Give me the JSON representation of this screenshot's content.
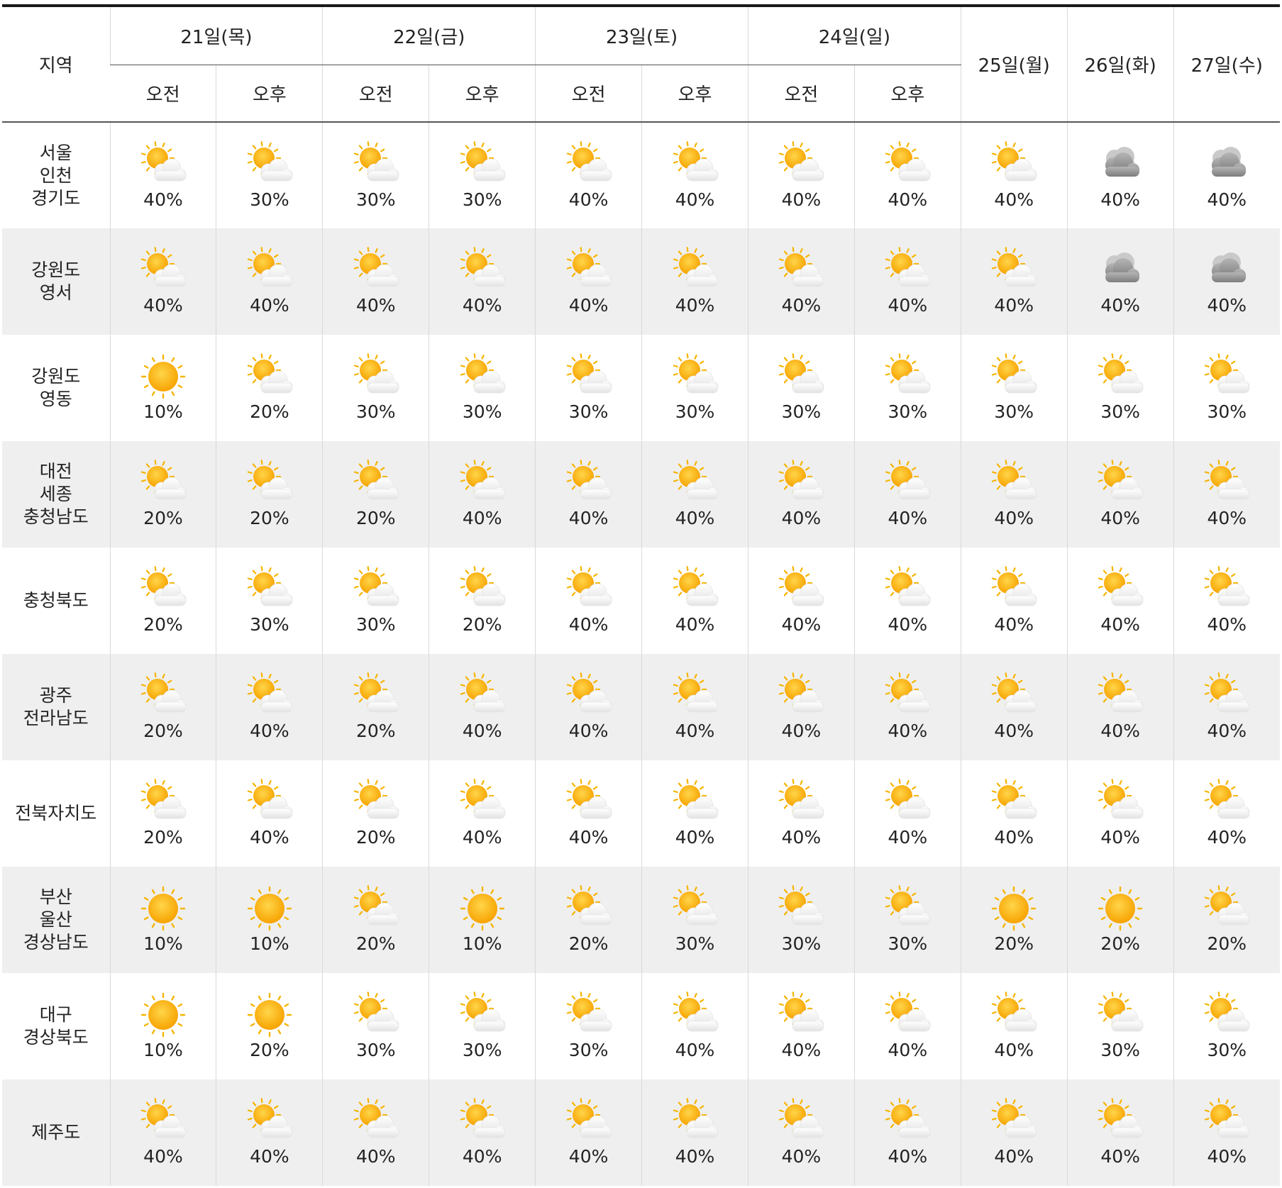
{
  "header": {
    "region_label": "지역",
    "dates": [
      {
        "label": "21일(목)",
        "split": true
      },
      {
        "label": "22일(금)",
        "split": true
      },
      {
        "label": "23일(토)",
        "split": true
      },
      {
        "label": "24일(일)",
        "split": true
      },
      {
        "label": "25일(월)",
        "split": false
      },
      {
        "label": "26일(화)",
        "split": false
      },
      {
        "label": "27일(수)",
        "split": false
      }
    ],
    "am_label": "오전",
    "pm_label": "오후"
  },
  "rows": [
    {
      "region": [
        "서울",
        "인천",
        "경기도"
      ],
      "cells": [
        {
          "icon": "partly-cloudy-icon",
          "pct": "40%"
        },
        {
          "icon": "partly-cloudy-icon",
          "pct": "30%"
        },
        {
          "icon": "partly-cloudy-icon",
          "pct": "30%"
        },
        {
          "icon": "partly-cloudy-icon",
          "pct": "30%"
        },
        {
          "icon": "partly-cloudy-icon",
          "pct": "40%"
        },
        {
          "icon": "partly-cloudy-icon",
          "pct": "40%"
        },
        {
          "icon": "partly-cloudy-icon",
          "pct": "40%"
        },
        {
          "icon": "partly-cloudy-icon",
          "pct": "40%"
        },
        {
          "icon": "partly-cloudy-icon",
          "pct": "40%"
        },
        {
          "icon": "overcast-icon",
          "pct": "40%"
        },
        {
          "icon": "overcast-icon",
          "pct": "40%"
        }
      ]
    },
    {
      "region": [
        "강원도",
        "영서"
      ],
      "cells": [
        {
          "icon": "partly-cloudy-icon",
          "pct": "40%"
        },
        {
          "icon": "partly-cloudy-icon",
          "pct": "40%"
        },
        {
          "icon": "partly-cloudy-icon",
          "pct": "40%"
        },
        {
          "icon": "partly-cloudy-icon",
          "pct": "40%"
        },
        {
          "icon": "partly-cloudy-icon",
          "pct": "40%"
        },
        {
          "icon": "partly-cloudy-icon",
          "pct": "40%"
        },
        {
          "icon": "partly-cloudy-icon",
          "pct": "40%"
        },
        {
          "icon": "partly-cloudy-icon",
          "pct": "40%"
        },
        {
          "icon": "partly-cloudy-icon",
          "pct": "40%"
        },
        {
          "icon": "overcast-icon",
          "pct": "40%"
        },
        {
          "icon": "overcast-icon",
          "pct": "40%"
        }
      ]
    },
    {
      "region": [
        "강원도",
        "영동"
      ],
      "cells": [
        {
          "icon": "sunny-icon",
          "pct": "10%"
        },
        {
          "icon": "partly-cloudy-icon",
          "pct": "20%"
        },
        {
          "icon": "partly-cloudy-icon",
          "pct": "30%"
        },
        {
          "icon": "partly-cloudy-icon",
          "pct": "30%"
        },
        {
          "icon": "partly-cloudy-icon",
          "pct": "30%"
        },
        {
          "icon": "partly-cloudy-icon",
          "pct": "30%"
        },
        {
          "icon": "partly-cloudy-icon",
          "pct": "30%"
        },
        {
          "icon": "partly-cloudy-icon",
          "pct": "30%"
        },
        {
          "icon": "partly-cloudy-icon",
          "pct": "30%"
        },
        {
          "icon": "partly-cloudy-icon",
          "pct": "30%"
        },
        {
          "icon": "partly-cloudy-icon",
          "pct": "30%"
        }
      ]
    },
    {
      "region": [
        "대전",
        "세종",
        "충청남도"
      ],
      "cells": [
        {
          "icon": "partly-cloudy-icon",
          "pct": "20%"
        },
        {
          "icon": "partly-cloudy-icon",
          "pct": "20%"
        },
        {
          "icon": "partly-cloudy-icon",
          "pct": "20%"
        },
        {
          "icon": "partly-cloudy-icon",
          "pct": "40%"
        },
        {
          "icon": "partly-cloudy-icon",
          "pct": "40%"
        },
        {
          "icon": "partly-cloudy-icon",
          "pct": "40%"
        },
        {
          "icon": "partly-cloudy-icon",
          "pct": "40%"
        },
        {
          "icon": "partly-cloudy-icon",
          "pct": "40%"
        },
        {
          "icon": "partly-cloudy-icon",
          "pct": "40%"
        },
        {
          "icon": "partly-cloudy-icon",
          "pct": "40%"
        },
        {
          "icon": "partly-cloudy-icon",
          "pct": "40%"
        }
      ]
    },
    {
      "region": [
        "충청북도"
      ],
      "cells": [
        {
          "icon": "partly-cloudy-icon",
          "pct": "20%"
        },
        {
          "icon": "partly-cloudy-icon",
          "pct": "30%"
        },
        {
          "icon": "partly-cloudy-icon",
          "pct": "30%"
        },
        {
          "icon": "partly-cloudy-icon",
          "pct": "20%"
        },
        {
          "icon": "partly-cloudy-icon",
          "pct": "40%"
        },
        {
          "icon": "partly-cloudy-icon",
          "pct": "40%"
        },
        {
          "icon": "partly-cloudy-icon",
          "pct": "40%"
        },
        {
          "icon": "partly-cloudy-icon",
          "pct": "40%"
        },
        {
          "icon": "partly-cloudy-icon",
          "pct": "40%"
        },
        {
          "icon": "partly-cloudy-icon",
          "pct": "40%"
        },
        {
          "icon": "partly-cloudy-icon",
          "pct": "40%"
        }
      ]
    },
    {
      "region": [
        "광주",
        "전라남도"
      ],
      "cells": [
        {
          "icon": "partly-cloudy-icon",
          "pct": "20%"
        },
        {
          "icon": "partly-cloudy-icon",
          "pct": "40%"
        },
        {
          "icon": "partly-cloudy-icon",
          "pct": "20%"
        },
        {
          "icon": "partly-cloudy-icon",
          "pct": "40%"
        },
        {
          "icon": "partly-cloudy-icon",
          "pct": "40%"
        },
        {
          "icon": "partly-cloudy-icon",
          "pct": "40%"
        },
        {
          "icon": "partly-cloudy-icon",
          "pct": "40%"
        },
        {
          "icon": "partly-cloudy-icon",
          "pct": "40%"
        },
        {
          "icon": "partly-cloudy-icon",
          "pct": "40%"
        },
        {
          "icon": "partly-cloudy-icon",
          "pct": "40%"
        },
        {
          "icon": "partly-cloudy-icon",
          "pct": "40%"
        }
      ]
    },
    {
      "region": [
        "전북자치도"
      ],
      "cells": [
        {
          "icon": "partly-cloudy-icon",
          "pct": "20%"
        },
        {
          "icon": "partly-cloudy-icon",
          "pct": "40%"
        },
        {
          "icon": "partly-cloudy-icon",
          "pct": "20%"
        },
        {
          "icon": "partly-cloudy-icon",
          "pct": "40%"
        },
        {
          "icon": "partly-cloudy-icon",
          "pct": "40%"
        },
        {
          "icon": "partly-cloudy-icon",
          "pct": "40%"
        },
        {
          "icon": "partly-cloudy-icon",
          "pct": "40%"
        },
        {
          "icon": "partly-cloudy-icon",
          "pct": "40%"
        },
        {
          "icon": "partly-cloudy-icon",
          "pct": "40%"
        },
        {
          "icon": "partly-cloudy-icon",
          "pct": "40%"
        },
        {
          "icon": "partly-cloudy-icon",
          "pct": "40%"
        }
      ]
    },
    {
      "region": [
        "부산",
        "울산",
        "경상남도"
      ],
      "cells": [
        {
          "icon": "sunny-icon",
          "pct": "10%"
        },
        {
          "icon": "sunny-icon",
          "pct": "10%"
        },
        {
          "icon": "partly-cloudy-icon",
          "pct": "20%"
        },
        {
          "icon": "sunny-icon",
          "pct": "10%"
        },
        {
          "icon": "partly-cloudy-icon",
          "pct": "20%"
        },
        {
          "icon": "partly-cloudy-icon",
          "pct": "30%"
        },
        {
          "icon": "partly-cloudy-icon",
          "pct": "30%"
        },
        {
          "icon": "partly-cloudy-icon",
          "pct": "30%"
        },
        {
          "icon": "sunny-icon",
          "pct": "20%"
        },
        {
          "icon": "sunny-icon",
          "pct": "20%"
        },
        {
          "icon": "partly-cloudy-icon",
          "pct": "20%"
        }
      ]
    },
    {
      "region": [
        "대구",
        "경상북도"
      ],
      "cells": [
        {
          "icon": "sunny-icon",
          "pct": "10%"
        },
        {
          "icon": "sunny-icon",
          "pct": "20%"
        },
        {
          "icon": "partly-cloudy-icon",
          "pct": "30%"
        },
        {
          "icon": "partly-cloudy-icon",
          "pct": "30%"
        },
        {
          "icon": "partly-cloudy-icon",
          "pct": "30%"
        },
        {
          "icon": "partly-cloudy-icon",
          "pct": "40%"
        },
        {
          "icon": "partly-cloudy-icon",
          "pct": "40%"
        },
        {
          "icon": "partly-cloudy-icon",
          "pct": "40%"
        },
        {
          "icon": "partly-cloudy-icon",
          "pct": "40%"
        },
        {
          "icon": "partly-cloudy-icon",
          "pct": "30%"
        },
        {
          "icon": "partly-cloudy-icon",
          "pct": "30%"
        }
      ]
    },
    {
      "region": [
        "제주도"
      ],
      "cells": [
        {
          "icon": "partly-cloudy-icon",
          "pct": "40%"
        },
        {
          "icon": "partly-cloudy-icon",
          "pct": "40%"
        },
        {
          "icon": "partly-cloudy-icon",
          "pct": "40%"
        },
        {
          "icon": "partly-cloudy-icon",
          "pct": "40%"
        },
        {
          "icon": "partly-cloudy-icon",
          "pct": "40%"
        },
        {
          "icon": "partly-cloudy-icon",
          "pct": "40%"
        },
        {
          "icon": "partly-cloudy-icon",
          "pct": "40%"
        },
        {
          "icon": "partly-cloudy-icon",
          "pct": "40%"
        },
        {
          "icon": "partly-cloudy-icon",
          "pct": "40%"
        },
        {
          "icon": "partly-cloudy-icon",
          "pct": "40%"
        },
        {
          "icon": "partly-cloudy-icon",
          "pct": "40%"
        }
      ]
    }
  ]
}
